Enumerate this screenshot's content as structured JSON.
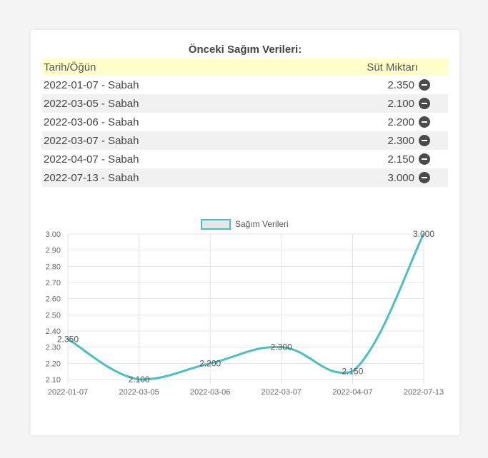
{
  "title": "Önceki Sağım Verileri:",
  "table": {
    "headers": [
      "Tarih/Öğün",
      "Süt Miktarı"
    ],
    "rows": [
      {
        "label": "2022-01-07 - Sabah",
        "value": "2.350"
      },
      {
        "label": "2022-03-05 - Sabah",
        "value": "2.100"
      },
      {
        "label": "2022-03-06 - Sabah",
        "value": "2.200"
      },
      {
        "label": "2022-03-07 - Sabah",
        "value": "2.300"
      },
      {
        "label": "2022-04-07 - Sabah",
        "value": "2.150"
      },
      {
        "label": "2022-07-13 - Sabah",
        "value": "3.000"
      }
    ],
    "row_action_icon": "minus-circle-icon"
  },
  "chart_data": {
    "type": "line",
    "categories": [
      "2022-01-07",
      "2022-03-05",
      "2022-03-06",
      "2022-03-07",
      "2022-04-07",
      "2022-07-13"
    ],
    "series": [
      {
        "name": "Sağım Verileri",
        "values": [
          2.35,
          2.1,
          2.2,
          2.3,
          2.15,
          3.0
        ],
        "color": "#4bc0c0"
      }
    ],
    "data_labels": [
      "2.350",
      "2.100",
      "2.200",
      "2.300",
      "2.150",
      "3.000"
    ],
    "yticks": [
      "3.00",
      "2.90",
      "2.80",
      "2.70",
      "2.60",
      "2.50",
      "2.40",
      "2.30",
      "2.20",
      "2.10"
    ],
    "ylim": [
      2.1,
      3.0
    ],
    "grid": true,
    "legend": "top"
  }
}
